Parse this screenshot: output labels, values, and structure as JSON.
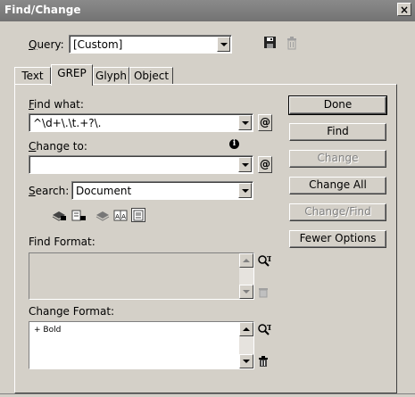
{
  "window": {
    "title": "Find/Change",
    "close_label": "×"
  },
  "query": {
    "label_prefix": "",
    "label_underlined": "Q",
    "label_rest": "uery:",
    "value": "[Custom]"
  },
  "tabs": [
    {
      "label": "Text"
    },
    {
      "label": "GREP"
    },
    {
      "label": "Glyph"
    },
    {
      "label": "Object"
    }
  ],
  "find_what": {
    "label_underlined": "F",
    "label_rest": "ind what:",
    "value": "^\\d+\\.\\t.+?\\."
  },
  "change_to": {
    "label_underlined": "C",
    "label_rest": "hange to:",
    "value": ""
  },
  "special_char_symbol": "@",
  "info_symbol": "i",
  "search": {
    "label_underlined": "S",
    "label_rest": "earch:",
    "value": "Document"
  },
  "find_format": {
    "label": "Find Format:",
    "items": []
  },
  "change_format": {
    "label": "Change Format:",
    "items": [
      "+ Bold"
    ]
  },
  "buttons": {
    "done": "Done",
    "find": "Find",
    "change": "Change",
    "change_all": "Change All",
    "change_find": "Change/Find",
    "fewer_options": "Fewer Options"
  },
  "colors": {
    "title_bar": "#7d7d7d",
    "background": "#d4d0c8",
    "disabled_text": "#808080"
  },
  "icons": [
    "save-query-icon",
    "delete-query-icon",
    "include-locked-layers-icon",
    "include-locked-stories-icon",
    "include-hidden-layers-icon",
    "include-master-pages-icon",
    "include-footnotes-icon",
    "specify-attributes-icon",
    "clear-attributes-icon"
  ]
}
